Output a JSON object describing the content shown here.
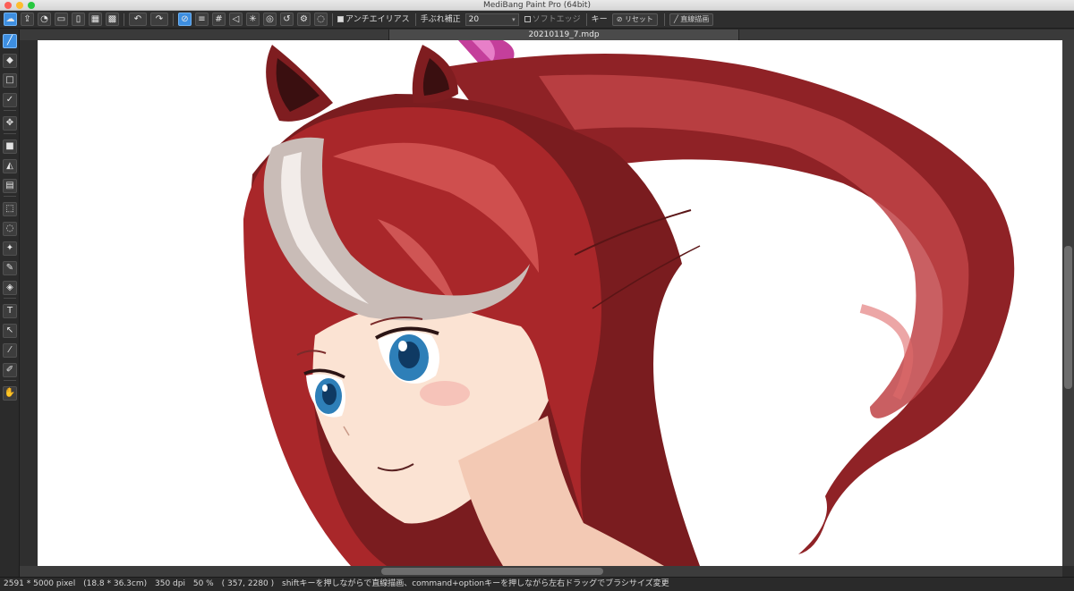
{
  "window": {
    "title": "MediBang Paint Pro (64bit)"
  },
  "toolbar": {
    "antialias_label": "アンチエイリアス",
    "antialias_checked": true,
    "stabilizer_label": "手ぶれ補正",
    "stabilizer_value": "20",
    "soft_edge_label": "ソフトエッジ",
    "soft_edge_checked": false,
    "key_label": "キー",
    "reset_label": "リセット",
    "line_draw_label": "直線描画"
  },
  "document": {
    "tab_title": "20210119_7.mdp"
  },
  "tools": [
    {
      "name": "brush-tool",
      "icon": "brush-icon",
      "glyph": "╱",
      "active": true
    },
    {
      "name": "eraser-tool",
      "icon": "eraser-icon",
      "glyph": "◆",
      "active": false
    },
    {
      "name": "dot-tool",
      "icon": "square-outline-icon",
      "glyph": "□",
      "active": false
    },
    {
      "name": "select-pen-tool",
      "icon": "check-pen-icon",
      "glyph": "✓",
      "active": false
    },
    {
      "name": "move-tool",
      "icon": "move-icon",
      "glyph": "✥",
      "active": false
    },
    {
      "name": "shape-tool",
      "icon": "square-filled-icon",
      "glyph": "■",
      "active": false
    },
    {
      "name": "bucket-tool",
      "icon": "bucket-icon",
      "glyph": "◭",
      "active": false
    },
    {
      "name": "gradient-tool",
      "icon": "gradient-icon",
      "glyph": "▤",
      "active": false
    },
    {
      "name": "rect-select-tool",
      "icon": "marquee-icon",
      "glyph": "⬚",
      "active": false
    },
    {
      "name": "lasso-tool",
      "icon": "lasso-icon",
      "glyph": "◌",
      "active": false
    },
    {
      "name": "magic-wand-tool",
      "icon": "magic-wand-icon",
      "glyph": "✦",
      "active": false
    },
    {
      "name": "select-pen-2-tool",
      "icon": "select-pen-icon",
      "glyph": "✎",
      "active": false
    },
    {
      "name": "select-eraser-tool",
      "icon": "select-eraser-icon",
      "glyph": "◈",
      "active": false
    },
    {
      "name": "text-tool",
      "icon": "text-icon",
      "glyph": "T",
      "active": false
    },
    {
      "name": "operation-tool",
      "icon": "pointer-icon",
      "glyph": "↖",
      "active": false
    },
    {
      "name": "eyedropper-tool",
      "icon": "eyedropper-icon",
      "glyph": "⁄",
      "active": false
    },
    {
      "name": "divide-tool",
      "icon": "pen-nib-icon",
      "glyph": "✐",
      "active": false
    },
    {
      "name": "hand-tool",
      "icon": "hand-icon",
      "glyph": "✋",
      "active": false
    }
  ],
  "status": {
    "size": "2591 * 5000 pixel",
    "size_cm": "(18.8 * 36.3cm)",
    "dpi": "350 dpi",
    "zoom": "50 %",
    "cursor": "( 357, 2280 )",
    "hint": "shiftキーを押しながらで直線描画、command+optionキーを押しながら左右ドラッグでブラシサイズ変更"
  },
  "colors": {
    "hair": "#a9272a",
    "hair_dark": "#6e1a1c",
    "hair_light": "#d85a58",
    "skin": "#fbe3d3",
    "eye": "#2e7fb8",
    "ribbon": "#c43f9b",
    "accent_active": "#3d8ee0"
  }
}
